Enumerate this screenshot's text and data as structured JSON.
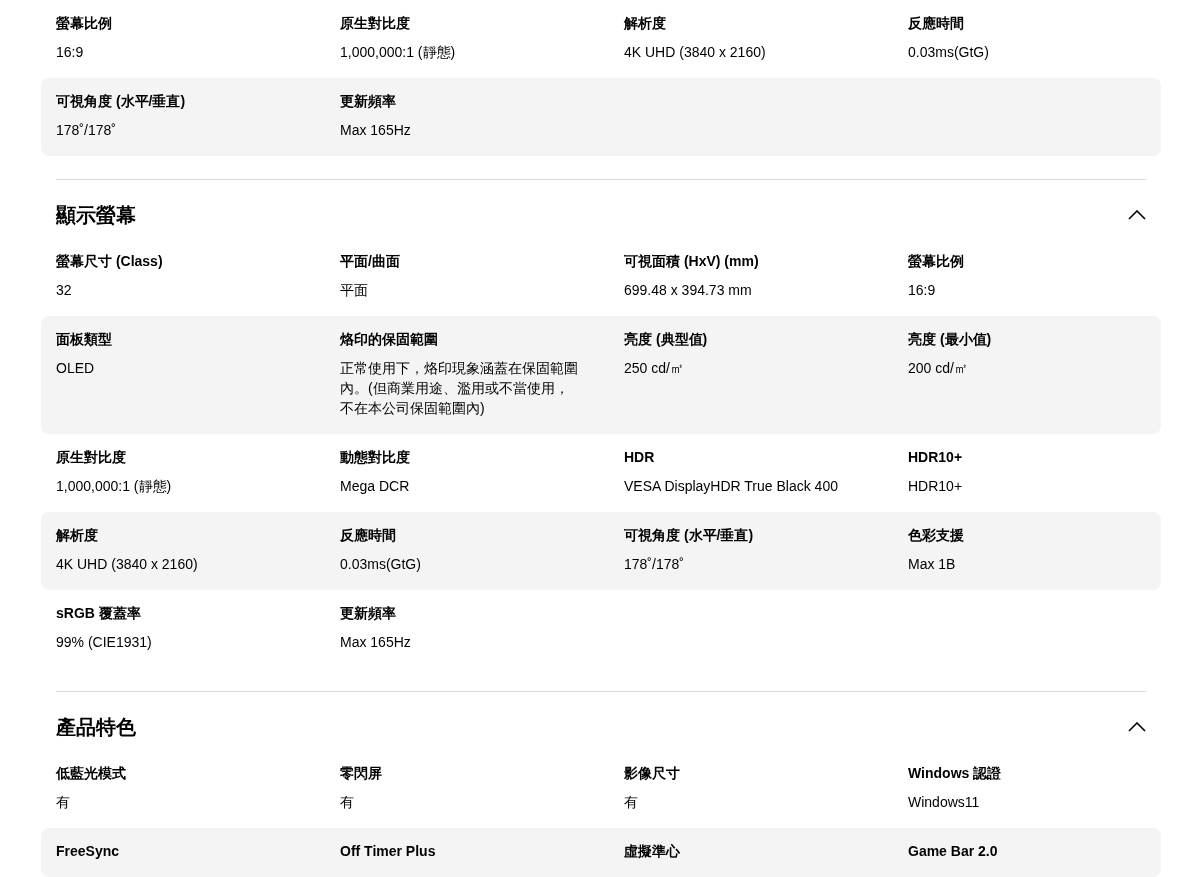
{
  "sections": [
    {
      "rows": [
        [
          {
            "label": "螢幕比例",
            "value": "16:9"
          },
          {
            "label": "原生對比度",
            "value": "1,000,000:1 (靜態)"
          },
          {
            "label": "解析度",
            "value": "4K UHD (3840 x 2160)"
          },
          {
            "label": "反應時間",
            "value": "0.03ms(GtG)"
          }
        ],
        [
          {
            "label": "可視角度 (水平/垂直)",
            "value": "178˚/178˚"
          },
          {
            "label": "更新頻率",
            "value": "Max 165Hz"
          }
        ]
      ]
    },
    {
      "title": "顯示螢幕",
      "expanded": true,
      "rows": [
        [
          {
            "label": "螢幕尺寸 (Class)",
            "value": "32"
          },
          {
            "label": "平面/曲面",
            "value": "平面"
          },
          {
            "label": "可視面積 (HxV) (mm)",
            "value": "699.48 x 394.73 mm"
          },
          {
            "label": "螢幕比例",
            "value": "16:9"
          }
        ],
        [
          {
            "label": "面板類型",
            "value": "OLED"
          },
          {
            "label": "烙印的保固範圍",
            "value": "正常使用下，烙印現象涵蓋在保固範圍內。(但商業用途、濫用或不當使用，不在本公司保固範圍內)"
          },
          {
            "label": "亮度 (典型值)",
            "value": "250 cd/㎡"
          },
          {
            "label": "亮度 (最小值)",
            "value": "200 cd/㎡"
          }
        ],
        [
          {
            "label": "原生對比度",
            "value": "1,000,000:1 (靜態)"
          },
          {
            "label": "動態對比度",
            "value": "Mega DCR"
          },
          {
            "label": "HDR",
            "value": "VESA DisplayHDR True Black 400"
          },
          {
            "label": "HDR10+",
            "value": "HDR10+"
          }
        ],
        [
          {
            "label": "解析度",
            "value": "4K UHD (3840 x 2160)"
          },
          {
            "label": "反應時間",
            "value": "0.03ms(GtG)"
          },
          {
            "label": "可視角度 (水平/垂直)",
            "value": "178˚/178˚"
          },
          {
            "label": "色彩支援",
            "value": "Max 1B"
          }
        ],
        [
          {
            "label": "sRGB 覆蓋率",
            "value": "99% (CIE1931)"
          },
          {
            "label": "更新頻率",
            "value": "Max 165Hz"
          }
        ]
      ]
    },
    {
      "title": "產品特色",
      "expanded": true,
      "rows": [
        [
          {
            "label": "低藍光模式",
            "value": "有"
          },
          {
            "label": "零閃屏",
            "value": "有"
          },
          {
            "label": "影像尺寸",
            "value": "有"
          },
          {
            "label": "Windows 認證",
            "value": "Windows11"
          }
        ],
        [
          {
            "label": "FreeSync"
          },
          {
            "label": "Off Timer Plus"
          },
          {
            "label": "虛擬準心"
          },
          {
            "label": "Game Bar 2.0"
          }
        ]
      ]
    }
  ]
}
